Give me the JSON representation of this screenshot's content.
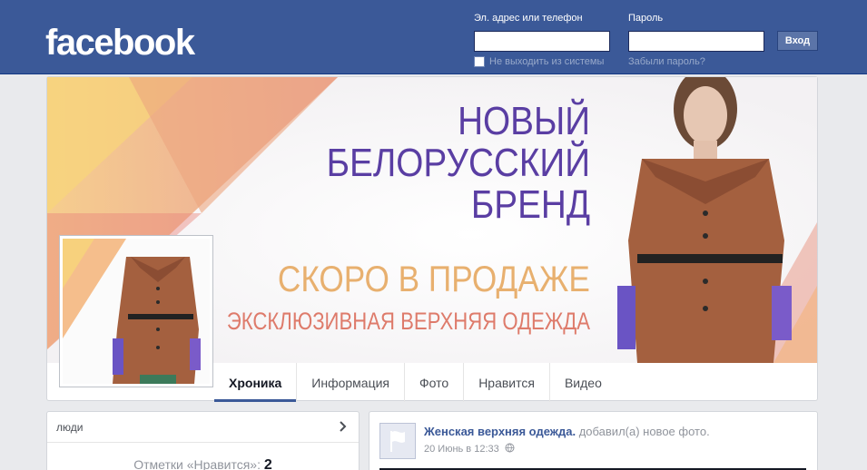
{
  "header": {
    "logo": "facebook",
    "email_label": "Эл. адрес или телефон",
    "email_value": "",
    "password_label": "Пароль",
    "password_value": "",
    "login_button": "Вход",
    "keep_logged_in": "Не выходить из системы",
    "forgot_password": "Забыли пароль?"
  },
  "cover": {
    "headline_1": "НОВЫЙ",
    "headline_2": "БЕЛОРУССКИЙ",
    "headline_3": "БРЕНД",
    "soon": "СКОРО В ПРОДАЖЕ",
    "exclusive": "ЭКСКЛЮЗИВНАЯ ВЕРХНЯЯ ОДЕЖДА"
  },
  "tabs": [
    {
      "label": "Хроника",
      "active": true
    },
    {
      "label": "Информация",
      "active": false
    },
    {
      "label": "Фото",
      "active": false
    },
    {
      "label": "Нравится",
      "active": false
    },
    {
      "label": "Видео",
      "active": false
    }
  ],
  "people": {
    "title": "люди",
    "likes_label": "Отметки «Нравится»:",
    "likes_count": "2"
  },
  "post": {
    "author": "Женская верхняя одежда.",
    "action": "добавил(а) новое фото.",
    "time": "20 Июнь в 12:33",
    "privacy_icon": "globe-icon"
  },
  "colors": {
    "brand_blue": "#3b5998",
    "cover_purple": "#5a3ea3",
    "cover_gold": "#e8b06f",
    "cover_coral": "#de7b6b"
  }
}
